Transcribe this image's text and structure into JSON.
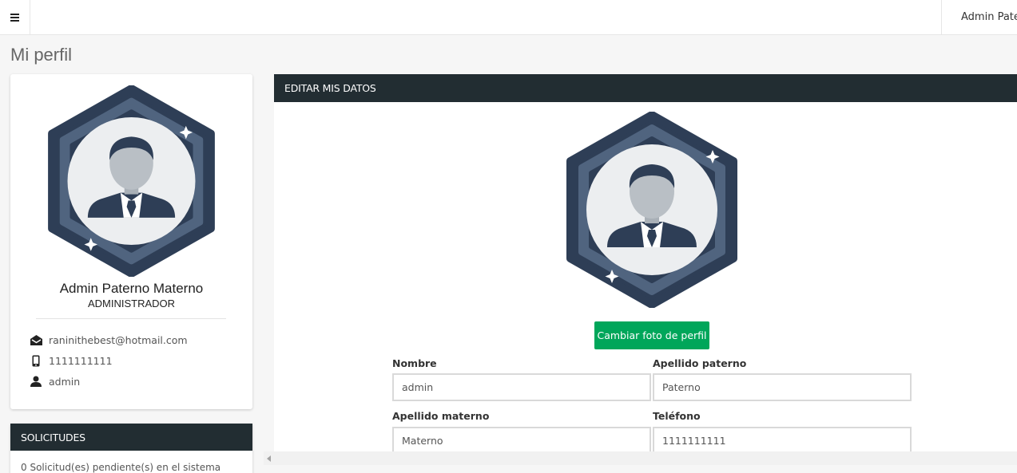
{
  "topbar": {
    "menu_icon": "hamburger-icon",
    "user_name": "Admin Paterno Materno",
    "user_icon": "user-avatar-icon"
  },
  "page": {
    "title": "Mi perfil"
  },
  "profile_card": {
    "name": "Admin Paterno Materno",
    "role": "ADMINISTRADOR",
    "email": "raninithebest@hotmail.com",
    "phone": "1111111111",
    "username": "admin"
  },
  "solicitudes": {
    "title": "SOLICITUDES",
    "text": "0 Solicitud(es) pendiente(s) en el sistema"
  },
  "edit_card": {
    "title": "EDITAR MIS DATOS",
    "change_photo_label": "Cambiar foto de perfil",
    "fields": {
      "nombre": {
        "label": "Nombre",
        "value": "admin"
      },
      "paterno": {
        "label": "Apellido paterno",
        "value": "Paterno"
      },
      "materno": {
        "label": "Apellido materno",
        "value": "Materno"
      },
      "telefono": {
        "label": "Teléfono",
        "value": "1111111111"
      }
    }
  },
  "colors": {
    "header_dark": "#222d32",
    "success_green": "#00a65a",
    "avatar_dark": "#2e3e56",
    "avatar_mid": "#4a5f7c"
  }
}
